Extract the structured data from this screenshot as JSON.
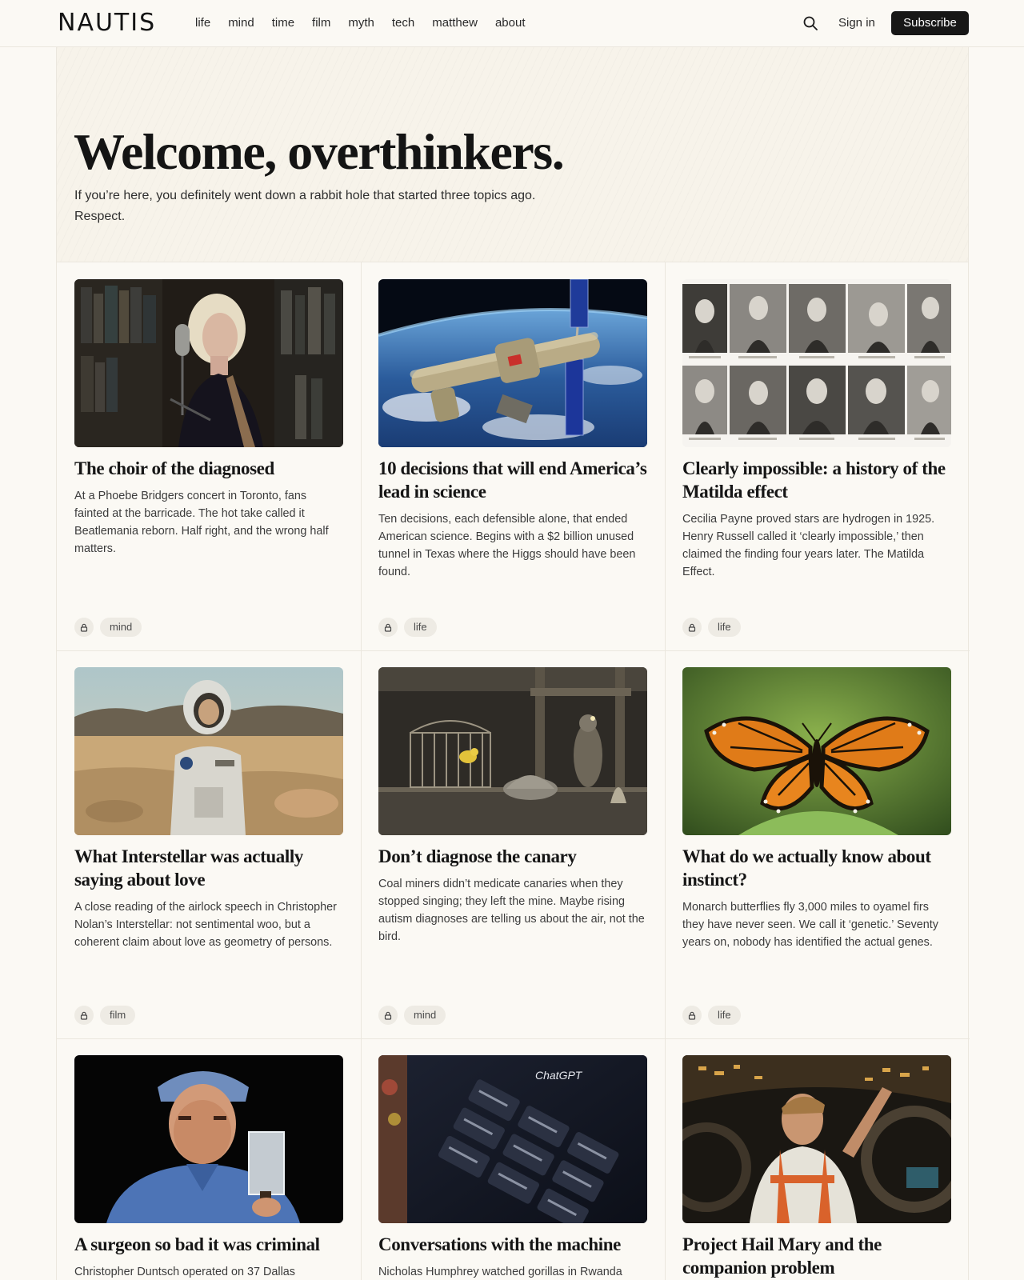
{
  "brand": {
    "logo": "NAUTIS"
  },
  "nav": {
    "items": [
      "life",
      "mind",
      "time",
      "film",
      "myth",
      "tech",
      "matthew",
      "about"
    ],
    "search_icon": "search-icon",
    "signin_label": "Sign in",
    "subscribe_label": "Subscribe"
  },
  "hero": {
    "title": "Welcome, overthinkers.",
    "subtitle": "If you’re here, you definitely went down a rabbit hole that started three topics ago. Respect."
  },
  "articles": [
    {
      "title": "The choir of the diagnosed",
      "description": "At a Phoebe Bridgers concert in Toronto, fans fainted at the barricade. The hot take called it Beatlemania reborn. Half right, and the wrong half matters.",
      "tag": "mind",
      "locked": true
    },
    {
      "title": "10 decisions that will end America’s lead in science",
      "description": "Ten decisions, each defensible alone, that ended American science. Begins with a $2 billion unused tunnel in Texas where the Higgs should have been found.",
      "tag": "life",
      "locked": true
    },
    {
      "title": "Clearly impossible: a history of the Matilda effect",
      "description": "Cecilia Payne proved stars are hydrogen in 1925. Henry Russell called it ‘clearly impossible,’ then claimed the finding four years later. The Matilda Effect.",
      "tag": "life",
      "locked": true
    },
    {
      "title": "What Interstellar was actually saying about love",
      "description": "A close reading of the airlock speech in Christopher Nolan’s Interstellar: not sentimental woo, but a coherent claim about love as geometry of persons.",
      "tag": "film",
      "locked": true
    },
    {
      "title": "Don’t diagnose the canary",
      "description": "Coal miners didn’t medicate canaries when they stopped singing; they left the mine. Maybe rising autism diagnoses are telling us about the air, not the bird.",
      "tag": "mind",
      "locked": true
    },
    {
      "title": "What do we actually know about instinct?",
      "description": "Monarch butterflies fly 3,000 miles to oyamel firs they have never seen. We call it ‘genetic.’ Seventy years on, nobody has identified the actual genes.",
      "tag": "life",
      "locked": true
    },
    {
      "title": "A surgeon so bad it was criminal",
      "description": "Christopher Duntsch operated on 37 Dallas",
      "tag": "",
      "locked": true
    },
    {
      "title": "Conversations with the machine",
      "description": "Nicholas Humphrey watched gorillas in Rwanda",
      "tag": "",
      "locked": true
    },
    {
      "title": "Project Hail Mary and the companion problem",
      "description": "",
      "tag": "",
      "locked": true
    }
  ],
  "image_captions": {
    "chatgpt_screen": "ChatGPT"
  }
}
